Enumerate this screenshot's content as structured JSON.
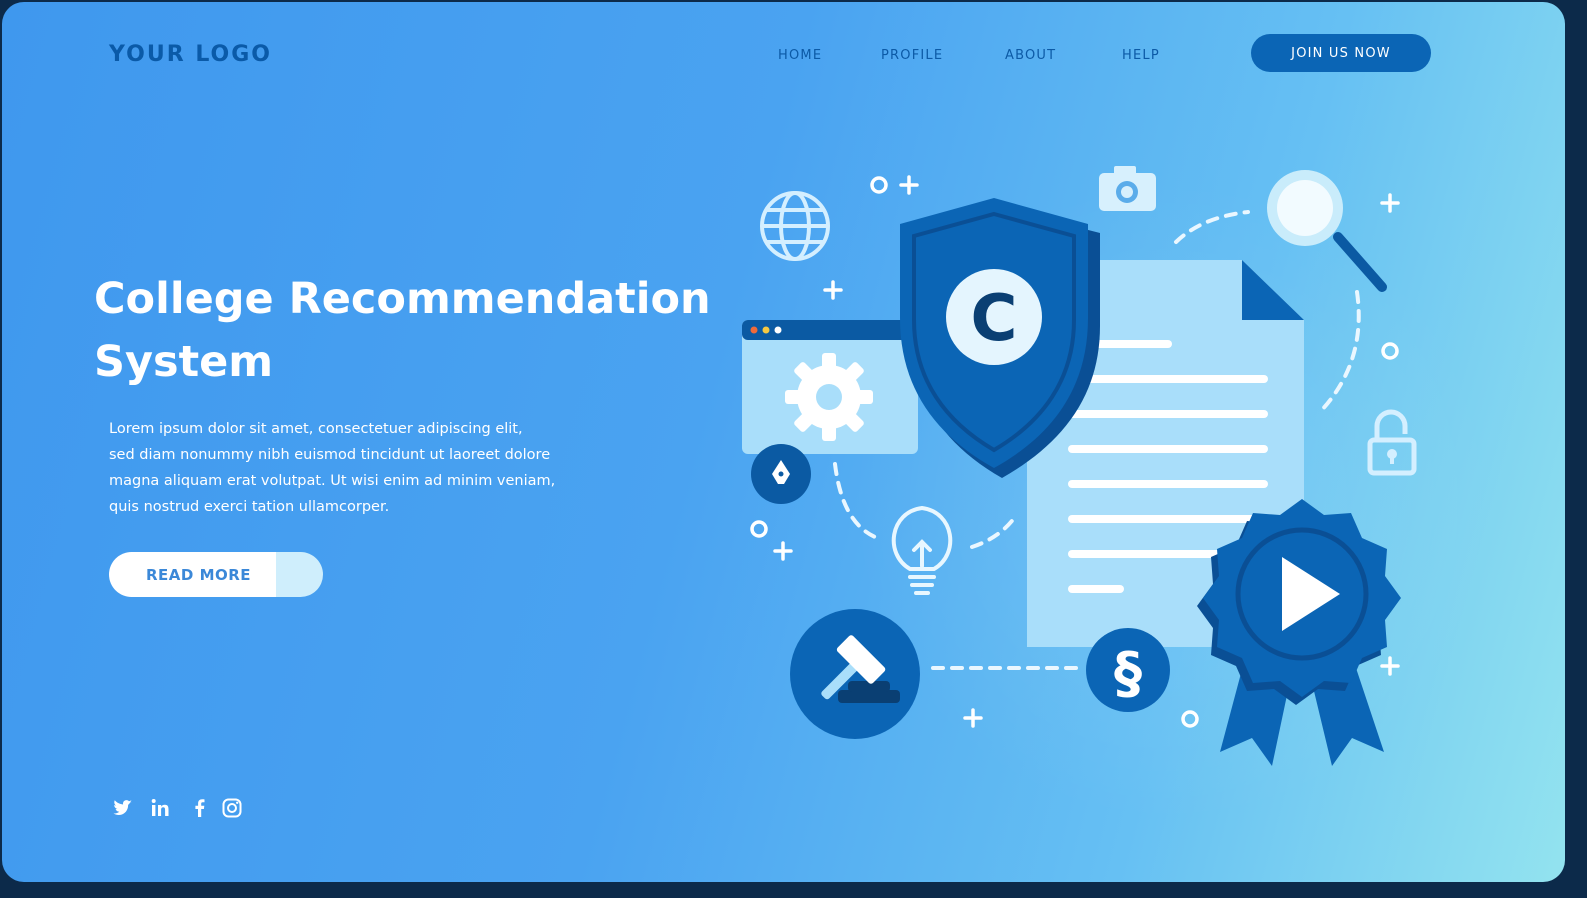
{
  "header": {
    "logo": "YOUR LOGO",
    "nav": [
      "HOME",
      "PROFILE",
      "ABOUT",
      "HELP"
    ],
    "cta": "JOIN US NOW"
  },
  "hero": {
    "title_line1": "College Recommendation",
    "title_line2": "System",
    "description_lines": [
      "Lorem ipsum dolor sit amet, consectetuer adipiscing elit,",
      "sed diam nonummy nibh euismod tincidunt ut laoreet dolore",
      "magna aliquam erat volutpat. Ut wisi enim ad minim veniam,",
      "quis nostrud exerci tation ullamcorper."
    ],
    "button": "READ MORE"
  },
  "shield_letter": "C",
  "section_symbol": "§",
  "social_icons": [
    "twitter-icon",
    "linkedin-icon",
    "facebook-icon",
    "instagram-icon"
  ],
  "colors": {
    "bg_left": "#3f98ee",
    "bg_right": "#93e3ef",
    "primary": "#0b65b5",
    "light": "#a8defb",
    "white": "#ffffff"
  }
}
